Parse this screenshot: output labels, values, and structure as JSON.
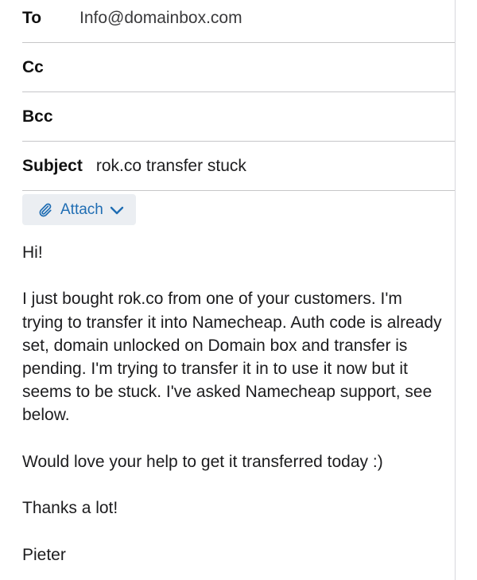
{
  "header": {
    "to_label": "To",
    "to_value": "Info@domainbox.com",
    "cc_label": "Cc",
    "bcc_label": "Bcc",
    "subject_label": "Subject",
    "subject_value": "rok.co transfer stuck"
  },
  "toolbar": {
    "attach_label": "Attach",
    "attach_icon": "paperclip-icon",
    "attach_chevron_icon": "chevron-down-icon",
    "accent_color": "#1f6db3"
  },
  "body": {
    "greeting": "Hi!",
    "paragraph_1": "I just bought rok.co from one of your customers. I'm trying to transfer it into Namecheap. Auth code is already set, domain unlocked on Domain box and transfer is pending. I'm trying to transfer it in to use it now but it seems to be stuck. I've asked Namecheap support, see below.",
    "paragraph_2": "Would love your help to get it transferred today :)",
    "closing": "Thanks a lot!",
    "signature": "Pieter"
  }
}
